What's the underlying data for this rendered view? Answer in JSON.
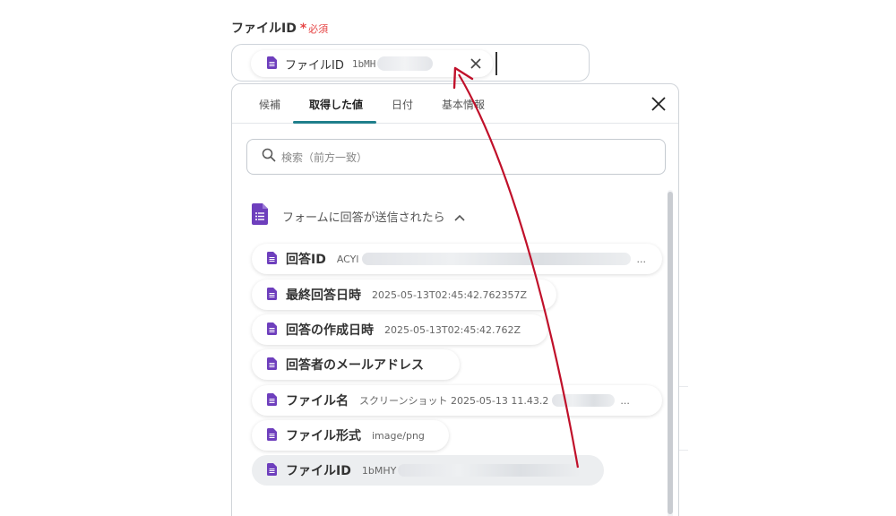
{
  "field": {
    "label": "ファイルID",
    "required_mark": "*",
    "required_text": "必須"
  },
  "chip": {
    "label": "ファイルID",
    "value": "1bMH"
  },
  "panel": {
    "tabs": [
      {
        "label": "候補"
      },
      {
        "label": "取得した値"
      },
      {
        "label": "日付"
      },
      {
        "label": "基本情報"
      }
    ],
    "search_placeholder": "検索（前方一致）",
    "group_title": "フォームに回答が送信されたら",
    "items": [
      {
        "name": "回答ID",
        "value": "ACYl"
      },
      {
        "name": "最終回答日時",
        "value": "2025-05-13T02:45:42.762357Z"
      },
      {
        "name": "回答の作成日時",
        "value": "2025-05-13T02:45:42.762Z"
      },
      {
        "name": "回答者のメールアドレス",
        "value": ""
      },
      {
        "name": "ファイル名",
        "value": "スクリーンショット 2025-05-13 11.43.2"
      },
      {
        "name": "ファイル形式",
        "value": "image/png"
      },
      {
        "name": "ファイルID",
        "value": "1bMHY"
      }
    ]
  },
  "icons": {
    "doc": "google-forms-doc-icon",
    "close": "close-icon",
    "search": "search-icon",
    "chevron": "chevron-up-icon"
  },
  "colors": {
    "doc_purple": "#6e3fbd",
    "required": "#e64545",
    "tab_underline": "#1f7f8c",
    "arrow": "#c0102a"
  }
}
